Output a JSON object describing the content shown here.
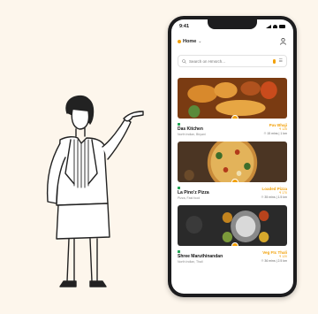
{
  "status_bar": {
    "time": "9:41"
  },
  "header": {
    "location_label": "Home",
    "location_chevron": "⌄"
  },
  "search": {
    "placeholder": "Search on Hmsrch...",
    "filter_glyph": "☰"
  },
  "restaurants": [
    {
      "name": "Das Kitchen",
      "cuisine": "North Indian, Biryani",
      "offer": "Pav Bhaji",
      "price": "₹ 125",
      "meta": "⏱ 15 mins | 1 km"
    },
    {
      "name": "La Pino'z Pizza",
      "cuisine": "Pizza, Fast food",
      "offer": "Loaded Pizza",
      "price": "₹ 170",
      "meta": "⏱ 35 mins | 1.5 km"
    },
    {
      "name": "Shree Maruthinandan",
      "cuisine": "North Indian, Thali",
      "offer": "Veg Ftc Thali",
      "price": "₹ 120",
      "meta": "⏱ 36 mins | 2.5 km"
    }
  ],
  "icons": {
    "location": "location-dot-icon",
    "profile": "user-icon",
    "search": "search-icon",
    "mic": "mic-icon",
    "filter": "filter-icon",
    "veg": "veg-indicator-icon"
  },
  "colors": {
    "accent": "#f2a007",
    "veg": "#23a455",
    "background": "#fdf6ec",
    "phone": "#1c1c1e"
  }
}
